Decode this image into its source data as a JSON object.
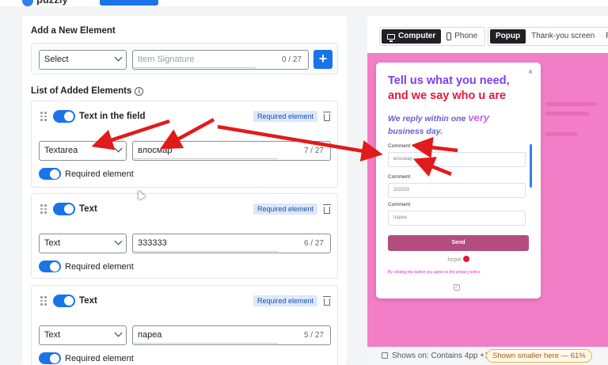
{
  "topbar": {
    "logo_text": "puzzly"
  },
  "add_element": {
    "title": "Add a New Element",
    "select_value": "Select",
    "signature_placeholder": "Item Signature",
    "signature_counter": "0 / 27"
  },
  "list": {
    "title": "List of Added Elements",
    "info": "i",
    "items": [
      {
        "title": "Text in the field",
        "badge": "Required element",
        "type": "Textarea",
        "value": "влосмар",
        "counter": "7 / 27",
        "required_label": "Required element"
      },
      {
        "title": "Text",
        "badge": "Required element",
        "type": "Text",
        "value": "333333",
        "counter": "6 / 27",
        "required_label": "Required element"
      },
      {
        "title": "Text",
        "badge": "Required element",
        "type": "Text",
        "value": "парea",
        "counter": "5 / 27",
        "required_label": "Required element"
      }
    ]
  },
  "preview_tabs": {
    "computer": "Computer",
    "phone": "Phone",
    "popup": "Popup",
    "thank_you": "Thank-you screen",
    "floating": "Flo"
  },
  "popup": {
    "close": "×",
    "heading_line1": "Tell us what you need,",
    "heading_line2": "and we say who u are",
    "sub_part1": "We reply within one ",
    "sub_big": "very",
    "sub_part2": "business day.",
    "fields": [
      {
        "label": "Comment",
        "value": "влосмар"
      },
      {
        "label": "Comment",
        "value": "333333"
      },
      {
        "label": "Comment",
        "value": "парea"
      }
    ],
    "send": "Send",
    "powered": "forpel",
    "privacy": "By clicking the button you agree to the privacy policy.",
    "check": "✓"
  },
  "footer": {
    "shows_on": "Shows on: Contains 4pp +1",
    "smaller": "Shown smaller here — 61%"
  },
  "colors": {
    "accent": "#1a73e8",
    "preview_bg": "#f27ec7",
    "arrow": "#e01b1b",
    "send_button": "#b34d7f"
  }
}
